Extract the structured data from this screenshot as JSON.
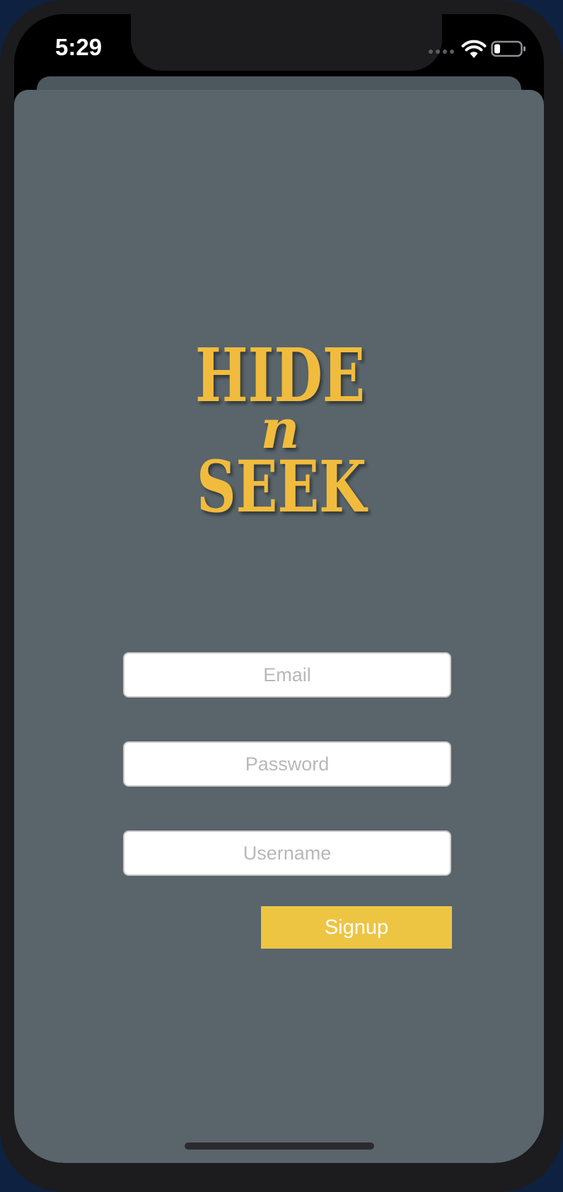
{
  "status_bar": {
    "time": "5:29",
    "icons": [
      "cellular-signal-icon",
      "wifi-icon",
      "battery-icon"
    ]
  },
  "logo": {
    "text_top": "HIDE",
    "text_middle": "n",
    "text_bottom": "SEEK",
    "color": "#f1bc3e"
  },
  "form": {
    "email_placeholder": "Email",
    "password_placeholder": "Password",
    "username_placeholder": "Username",
    "email_value": "",
    "password_value": "",
    "username_value": ""
  },
  "signup_button": {
    "label": "Signup",
    "color": "#eec443"
  },
  "colors": {
    "background": "#59656b",
    "field_border": "#c9c9c9",
    "placeholder": "#b8b8b8"
  }
}
